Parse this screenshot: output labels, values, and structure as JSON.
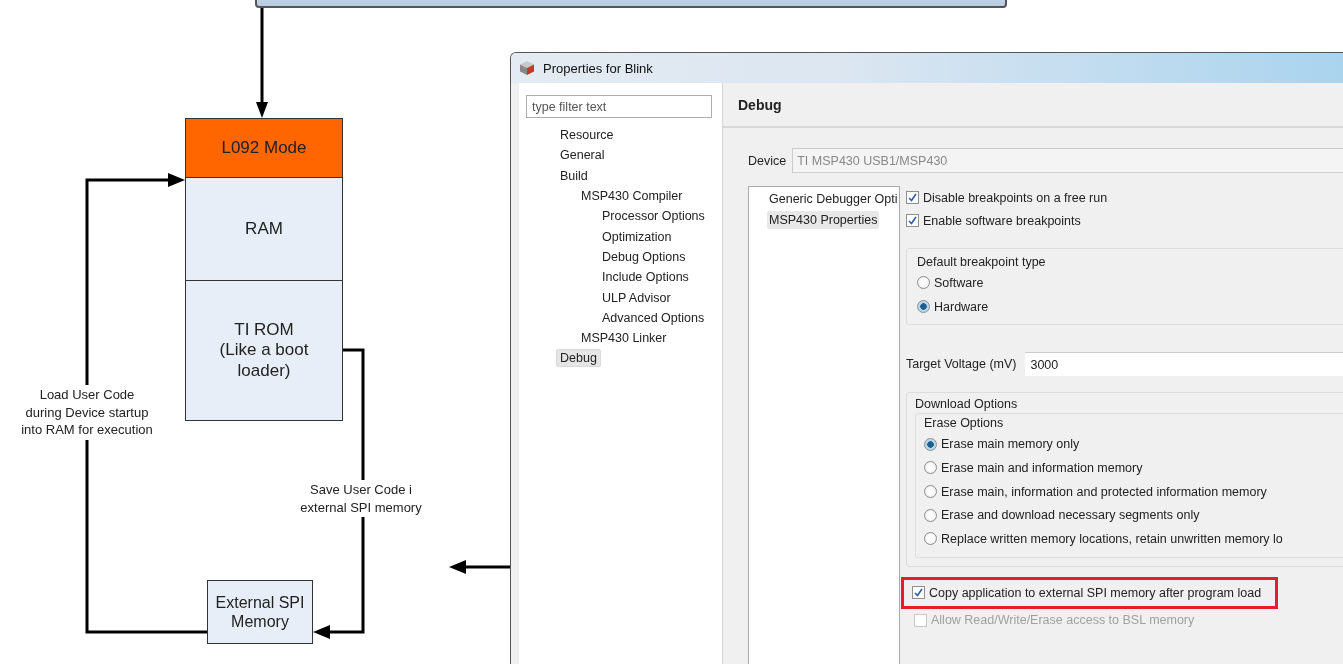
{
  "diagram": {
    "stack": [
      {
        "label": "L092 Mode",
        "kind": "highlight"
      },
      {
        "label": "RAM",
        "kind": "memory"
      },
      {
        "label": "TI ROM\n(Like a boot\nloader)",
        "kind": "memory"
      }
    ],
    "external": {
      "label": "External SPI\nMemory"
    },
    "load_label": "Load User Code\nduring Device startup\ninto RAM for execution",
    "save_label": "Save User Code i\nexternal SPI memory"
  },
  "dialog": {
    "title": "Properties for Blink",
    "filter": {
      "placeholder": "type filter text"
    },
    "tree": [
      {
        "label": "Resource",
        "selected": false
      },
      {
        "label": "General",
        "selected": false
      },
      {
        "label": "Build",
        "selected": false,
        "children": [
          {
            "label": "MSP430 Compiler",
            "selected": false,
            "children": [
              {
                "label": "Processor Options",
                "selected": false
              },
              {
                "label": "Optimization",
                "selected": false
              },
              {
                "label": "Debug Options",
                "selected": false
              },
              {
                "label": "Include Options",
                "selected": false
              },
              {
                "label": "ULP Advisor",
                "selected": false
              },
              {
                "label": "Advanced Options",
                "selected": false
              }
            ]
          },
          {
            "label": "MSP430 Linker",
            "selected": false
          }
        ]
      },
      {
        "label": "Debug",
        "selected": true
      }
    ],
    "page_title": "Debug",
    "device": {
      "label": "Device",
      "value": "TI MSP430 USB1/MSP430"
    },
    "categories": [
      {
        "label": "Generic Debugger Opti",
        "selected": false
      },
      {
        "label": "MSP430 Properties",
        "selected": true
      }
    ],
    "checks": [
      {
        "label": "Disable breakpoints on a free run",
        "checked": true
      },
      {
        "label": "Enable software breakpoints",
        "checked": true
      }
    ],
    "breakpoint_group": {
      "title": "Default breakpoint type",
      "options": [
        {
          "label": "Software",
          "selected": false
        },
        {
          "label": "Hardware",
          "selected": true
        }
      ]
    },
    "voltage": {
      "label": "Target Voltage (mV)",
      "value": "3000"
    },
    "download": {
      "title": "Download Options",
      "erase_title": "Erase Options",
      "erase_options": [
        {
          "label": "Erase main memory only",
          "selected": true
        },
        {
          "label": "Erase main and information memory",
          "selected": false
        },
        {
          "label": "Erase main, information and protected information memory",
          "selected": false
        },
        {
          "label": "Erase and download necessary segments only",
          "selected": false
        },
        {
          "label": "Replace written memory locations, retain unwritten memory lo",
          "selected": false
        }
      ]
    },
    "bottom_checks": [
      {
        "label": "Copy application to external SPI memory after program load",
        "checked": true,
        "disabled": false,
        "highlighted": true
      },
      {
        "label": "Allow Read/Write/Erase access to BSL memory",
        "checked": false,
        "disabled": true,
        "highlighted": false
      }
    ]
  }
}
